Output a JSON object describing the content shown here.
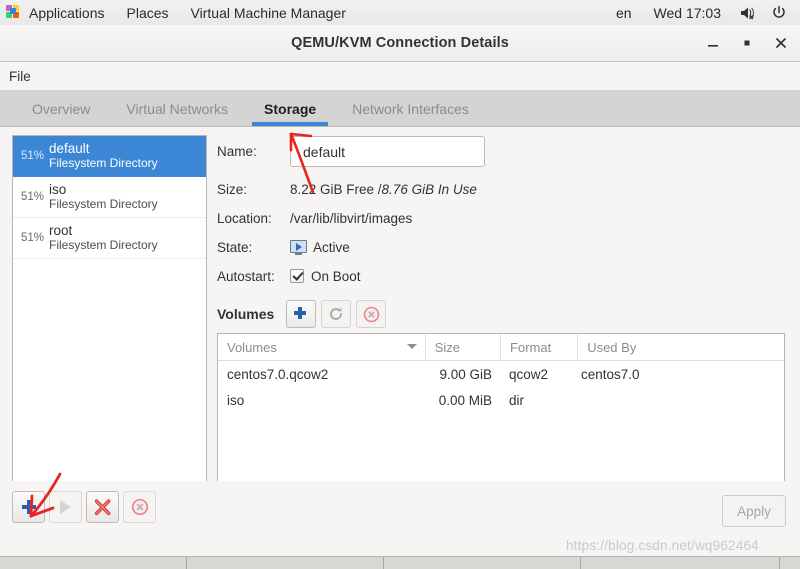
{
  "topbar": {
    "logo_icon": "gnome-applications-icon",
    "items": [
      "Applications",
      "Places",
      "Virtual Machine Manager"
    ],
    "keyboard_layout": "en",
    "clock": "Wed 17:03",
    "volume_icon": "speaker-muted-icon",
    "power_icon": "power-icon"
  },
  "window": {
    "title": "QEMU/KVM Connection Details",
    "minimize_icon": "minimize-icon",
    "maximize_icon": "maximize-icon",
    "close_icon": "close-icon",
    "menu": [
      "File"
    ]
  },
  "tabs": [
    {
      "label": "Overview",
      "active": false
    },
    {
      "label": "Virtual Networks",
      "active": false
    },
    {
      "label": "Storage",
      "active": true
    },
    {
      "label": "Network Interfaces",
      "active": false
    }
  ],
  "pools": [
    {
      "percent": "51%",
      "name": "default",
      "type": "Filesystem Directory",
      "selected": true
    },
    {
      "percent": "51%",
      "name": "iso",
      "type": "Filesystem Directory",
      "selected": false
    },
    {
      "percent": "51%",
      "name": "root",
      "type": "Filesystem Directory",
      "selected": false
    }
  ],
  "details": {
    "name_label": "Name:",
    "name_value": "default",
    "size_label": "Size:",
    "size_free": "8.22 GiB Free / ",
    "size_inuse": "8.76 GiB In Use",
    "location_label": "Location:",
    "location_value": "/var/lib/libvirt/images",
    "state_label": "State:",
    "state_value": "Active",
    "state_icon": "monitor-active-icon",
    "autostart_label": "Autostart:",
    "autostart_value": "On Boot",
    "autostart_checked": true
  },
  "volumes": {
    "title": "Volumes",
    "toolbar": [
      {
        "name": "add-volume-button",
        "icon": "plus-icon",
        "enabled": true
      },
      {
        "name": "refresh-volumes-button",
        "icon": "refresh-icon",
        "enabled": false
      },
      {
        "name": "delete-volume-button",
        "icon": "delete-circle-icon",
        "enabled": false
      }
    ],
    "columns": [
      "Volumes",
      "Size",
      "Format",
      "Used By"
    ],
    "sort_column": "Volumes",
    "sort_direction": "descending",
    "rows": [
      {
        "volume": "centos7.0.qcow2",
        "size": "9.00 GiB",
        "format": "qcow2",
        "used_by": "centos7.0"
      },
      {
        "volume": "iso",
        "size": "0.00 MiB",
        "format": "dir",
        "used_by": ""
      }
    ]
  },
  "pool_toolbar": [
    {
      "name": "add-pool-button",
      "icon": "plus-icon",
      "enabled": true
    },
    {
      "name": "start-pool-button",
      "icon": "play-icon",
      "enabled": false
    },
    {
      "name": "stop-pool-button",
      "icon": "red-x-icon",
      "enabled": true
    },
    {
      "name": "delete-pool-button",
      "icon": "delete-circle-icon",
      "enabled": false
    }
  ],
  "apply_button": "Apply",
  "watermark": "https://blog.csdn.net/wq962464",
  "colors": {
    "accent_blue": "#3b87d6",
    "selection_blue": "#3b87d6",
    "plus_blue": "#2a5fb0",
    "delete_red": "#e04a4a",
    "annotation_red": "#e8251f",
    "window_bg": "#f6f5f4",
    "tabstrip_bg": "#d6d4d2"
  }
}
